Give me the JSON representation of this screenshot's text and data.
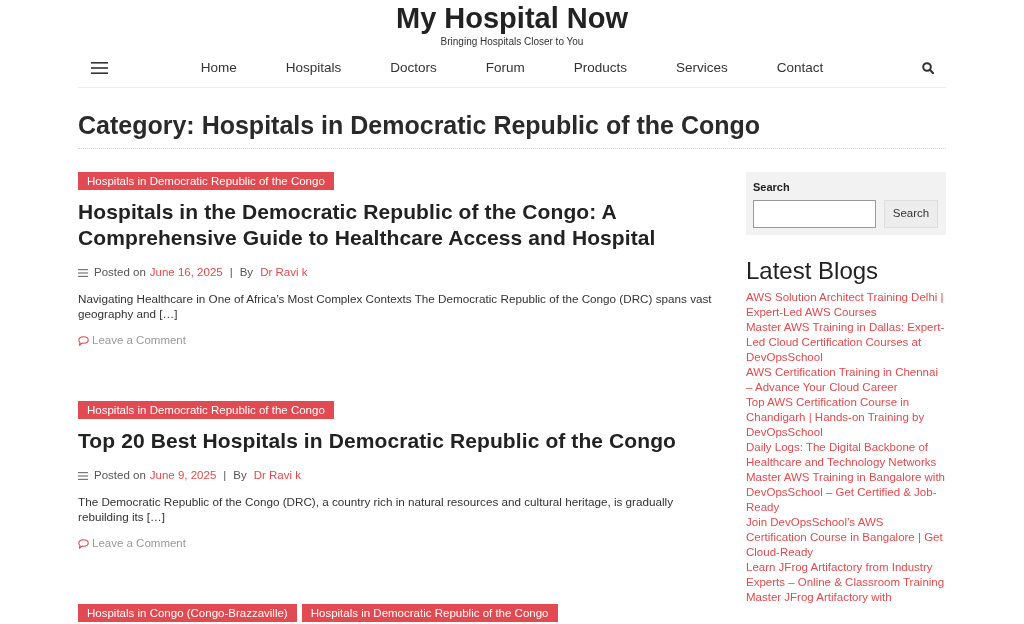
{
  "site": {
    "title": "My Hospital Now",
    "tagline": "Bringing Hospitals Closer to You"
  },
  "nav": {
    "items": [
      "Home",
      "Hospitals",
      "Doctors",
      "Forum",
      "Products",
      "Services",
      "Contact"
    ]
  },
  "page_title": "Category: Hospitals in Democratic Republic of the Congo",
  "posts": [
    {
      "categories": [
        "Hospitals in Democratic Republic of the Congo"
      ],
      "title": "Hospitals in the Democratic Republic of the Congo: A Comprehensive Guide to Healthcare Access and Hospital",
      "posted_label": "Posted on",
      "date": "June 16, 2025",
      "separator": "|",
      "by_label": "By",
      "author": "Dr Ravi k",
      "excerpt": "Navigating Healthcare in One of Africa’s Most Complex Contexts The Democratic Republic of the Congo (DRC) spans vast geography and […]",
      "comment_link": "Leave a Comment"
    },
    {
      "categories": [
        "Hospitals in Democratic Republic of the Congo"
      ],
      "title": "Top 20 Best Hospitals in Democratic Republic of the Congo",
      "posted_label": "Posted on",
      "date": "June 9, 2025",
      "separator": "|",
      "by_label": "By",
      "author": "Dr Ravi k",
      "excerpt": "The Democratic Republic of the Congo (DRC), a country rich in natural resources and cultural heritage, is gradually rebuilding its […]",
      "comment_link": "Leave a Comment"
    },
    {
      "categories": [
        "Hospitals in Congo (Congo-Brazzaville)",
        "Hospitals in Democratic Republic of the Congo"
      ]
    }
  ],
  "sidebar": {
    "search": {
      "label": "Search",
      "button": "Search"
    },
    "latest_blogs": {
      "title": "Latest Blogs",
      "links": [
        "AWS Solution Architect Training Delhi | Expert-Led AWS Courses",
        "Master AWS Training in Dallas: Expert-Led Cloud Certification Courses at DevOpsSchool",
        "AWS Certification Training in Chennai – Advance Your Cloud Career",
        "Top AWS Certification Course in Chandigarh | Hands-on Training by DevOpsSchool",
        "Daily Logs: The Digital Backbone of Healthcare and Technology Networks",
        "Master AWS Training in Bangalore with DevOpsSchool – Get Certified & Job-Ready",
        "Join DevOpsSchool’s AWS Certification Course in Bangalore | Get Cloud-Ready",
        "Learn JFrog Artifactory from Industry Experts – Online & Classroom Training",
        "Master JFrog Artifactory with"
      ]
    }
  }
}
